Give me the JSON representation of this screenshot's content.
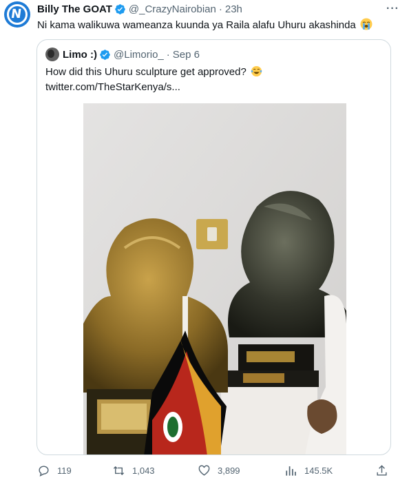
{
  "tweet": {
    "author_name": "Billy The GOAT",
    "author_handle": "@_CrazyNairobian",
    "separator": "·",
    "time": "23h",
    "text": "Ni kama walikuwa wameanza kuunda ya Raila alafu Uhuru akashinda",
    "emoji": "loudly-crying-face",
    "more_label": "···",
    "avatar_icon": "N-logo-icon",
    "brand_color": "#1e7bd6",
    "verified_color": "#1d9bf0"
  },
  "quoted": {
    "author_name": "Limo :)",
    "author_handle": "@Limorio_",
    "separator": "·",
    "date": "Sep 6",
    "text": "How did this Uhuru sculpture get approved?",
    "emoji": "face-with-tears-of-joy",
    "link": "twitter.com/TheStarKenya/s..."
  },
  "actions": {
    "replies": "119",
    "retweets": "1,043",
    "likes": "3,899",
    "views": "145.5K"
  }
}
